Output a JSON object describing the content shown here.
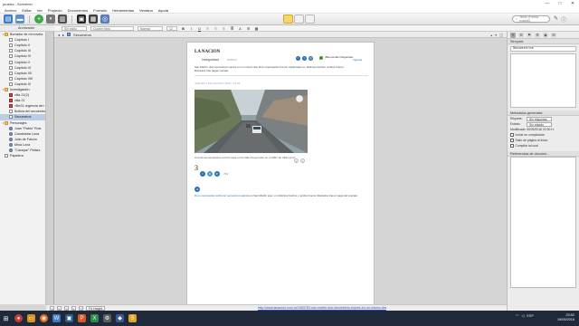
{
  "window": {
    "title": "prueba - Scrivener",
    "controls": [
      "—",
      "□",
      "✕"
    ]
  },
  "menu": [
    "Archivo",
    "Editar",
    "Ver",
    "Proyecto",
    "Documentos",
    "Formato",
    "Herramientas",
    "Ventana",
    "Ayuda"
  ],
  "toolbar": {
    "search_placeholder": "Texto (Forma exacta)"
  },
  "formatbar": {
    "style": "Sin estilo",
    "font": "Courier New",
    "weight": "Normal",
    "size": "12",
    "buttons": [
      "B",
      "I",
      "U"
    ]
  },
  "binder": {
    "header": "Archivador",
    "items": [
      {
        "label": "Borrador de mi novela",
        "icon": "folder",
        "indent": 0,
        "arrow": "▾"
      },
      {
        "label": "Capítulo I",
        "icon": "doc",
        "indent": 1
      },
      {
        "label": "Capítulo II",
        "icon": "doc",
        "indent": 1
      },
      {
        "label": "Capítulo III",
        "icon": "doc",
        "indent": 1
      },
      {
        "label": "Capítulo IV",
        "icon": "doc",
        "indent": 1
      },
      {
        "label": "Capítulo V",
        "icon": "doc",
        "indent": 1
      },
      {
        "label": "Capítulo VI",
        "icon": "doc",
        "indent": 1
      },
      {
        "label": "Capítulo VII",
        "icon": "doc",
        "indent": 1
      },
      {
        "label": "Capítulo VIII",
        "icon": "doc",
        "indent": 1
      },
      {
        "label": "Capítulo IX",
        "icon": "doc",
        "indent": 1
      },
      {
        "label": "Investigación",
        "icon": "folder",
        "indent": 0,
        "arrow": "▾"
      },
      {
        "label": "villa 21(2)",
        "icon": "red",
        "indent": 1
      },
      {
        "label": "villa 21",
        "icon": "red",
        "indent": 1
      },
      {
        "label": "«Be31 regencia de»",
        "icon": "red",
        "indent": 1
      },
      {
        "label": "Noticia del secuestro",
        "icon": "doc",
        "indent": 1
      },
      {
        "label": "Secuestros",
        "icon": "doc",
        "indent": 1,
        "selected": true
      },
      {
        "label": "Personajes",
        "icon": "folder",
        "indent": 0,
        "arrow": "▾"
      },
      {
        "label": "Juan \"Pablo\" Ruiz",
        "icon": "person",
        "indent": 1
      },
      {
        "label": "Candelaria Luna",
        "icon": "person",
        "indent": 1
      },
      {
        "label": "Julio de Falcón",
        "icon": "person",
        "indent": 1
      },
      {
        "label": "Mina Luna",
        "icon": "person",
        "indent": 1
      },
      {
        "label": "\"Cacique\" Peláez",
        "icon": "person",
        "indent": 1
      },
      {
        "label": "Papelera",
        "icon": "doc",
        "indent": 0
      }
    ]
  },
  "editor": {
    "doc_title": "Secuestros",
    "page": {
      "logo": "LA NACION",
      "section": "Inseguridad",
      "section_tag": "NUEVO",
      "account": "¡Bienvenido! Registrate",
      "login": "Ingresá",
      "lead": "San Martín: dos secuestros exprés en un mismo día. Dos empresarios fueron capturados en distintos barrios; ambos fueron liberados tras pagar rescate.",
      "byline": "JUEVES 4 DE AGOSTO 2016 • 17:42",
      "caption": "Una de las secuestros ocurrió aquí en la calle Pueyrredón en el 2007 de Villa Lynch",
      "count": "734",
      "num": "3",
      "body_hl": "Dos empresarios sufrieron secuestros",
      "body": " exprés en San Martín ayer, en distintos barrios y ambos fueron liberados tras el pago del rescate."
    }
  },
  "footer": {
    "zoom": "Fit Height",
    "url": "http://www.lanacion.com.ar/1983783-san-martin-dos-secuestros-expres-en-un-mismo-dia"
  },
  "inspector": {
    "synopsis_header": "Sinopsis",
    "title": "Secuestros",
    "meta_header": "Metadatos generales",
    "label_key": "Etiqueta:",
    "label_val": "Sin etiquetas",
    "status_key": "Estado:",
    "status_val": "Sin estado",
    "modified_key": "Modificado:",
    "modified_val": "30/09/2016 22:30 H.",
    "checks": [
      "Incluir en compilación",
      "Salto de página al inicio",
      "Compilar tal cual"
    ],
    "notes_header": "Referencias de docume..."
  },
  "taskbar": {
    "lang": "ESP",
    "time": "23:52",
    "date": "19/05/2016"
  },
  "colors": {
    "accent": "#2a6fb0",
    "taskbar": "#20293a"
  }
}
